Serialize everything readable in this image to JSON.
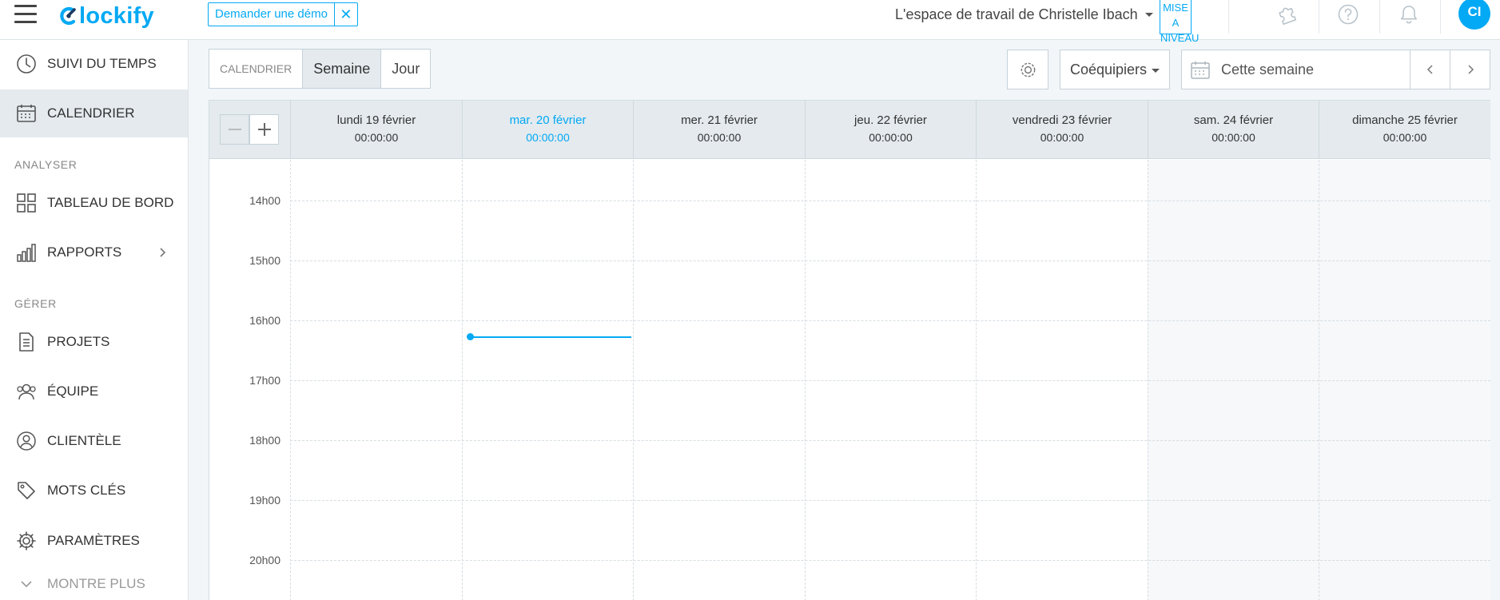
{
  "header": {
    "logo_text": "lockify",
    "demo_label": "Demander une démo",
    "workspace": "L'espace de travail de Christelle Ibach",
    "upgrade_line1": "MISE A",
    "upgrade_line2": "NIVEAU",
    "avatar_initials": "CI",
    "accent_color": "#03a9f4"
  },
  "sidebar": {
    "items": [
      {
        "label": "SUIVI DU TEMPS",
        "icon": "clock-icon"
      },
      {
        "label": "CALENDRIER",
        "icon": "calendar-icon"
      },
      {
        "label": "TABLEAU DE BORD",
        "icon": "dashboard-icon"
      },
      {
        "label": "RAPPORTS",
        "icon": "bar-chart-icon"
      },
      {
        "label": "PROJETS",
        "icon": "document-icon"
      },
      {
        "label": "ÉQUIPE",
        "icon": "team-icon"
      },
      {
        "label": "CLIENTÈLE",
        "icon": "client-icon"
      },
      {
        "label": "MOTS CLÉS",
        "icon": "tag-icon"
      },
      {
        "label": "PARAMÈTRES",
        "icon": "gear-icon"
      },
      {
        "label": "MONTRE PLUS",
        "icon": "chevron-down-icon"
      }
    ],
    "sections": [
      "ANALYSER",
      "GÉRER"
    ]
  },
  "toolbar": {
    "views": [
      "CALENDRIER",
      "Semaine",
      "Jour"
    ],
    "team_label": "Coéquipiers",
    "range_label": "Cette semaine"
  },
  "calendar": {
    "days": [
      {
        "name": "lundi 19 février",
        "total": "00:00:00"
      },
      {
        "name": "mar. 20 février",
        "total": "00:00:00"
      },
      {
        "name": "mer. 21 février",
        "total": "00:00:00"
      },
      {
        "name": "jeu. 22 février",
        "total": "00:00:00"
      },
      {
        "name": "vendredi 23 février",
        "total": "00:00:00"
      },
      {
        "name": "sam. 24 février",
        "total": "00:00:00"
      },
      {
        "name": "dimanche 25 février",
        "total": "00:00:00"
      }
    ],
    "hours": [
      "14h00",
      "15h00",
      "16h00",
      "17h00",
      "18h00",
      "19h00",
      "20h00"
    ]
  }
}
